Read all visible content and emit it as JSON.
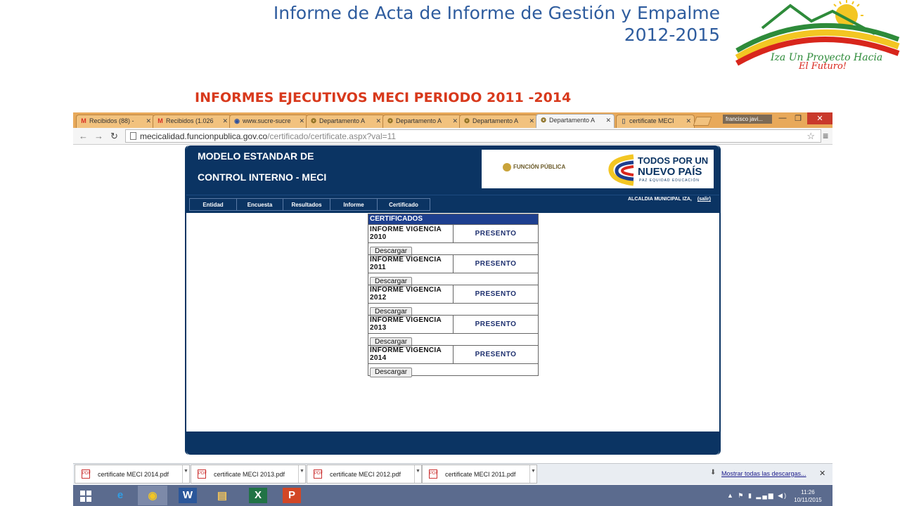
{
  "slide": {
    "title_line1": "Informe de Acta de Informe de Gestión y Empalme",
    "title_line2": "2012-2015",
    "subtitle": "INFORMES EJECUTIVOS MECI PERIODO 2011 -2014",
    "logo_text_line1": "Iza Un Proyecto Hacia",
    "logo_text_line2": "El Futuro!"
  },
  "browser": {
    "tabs": [
      {
        "label": "Recibidos (88) -",
        "icon": "gmail-icon",
        "active": false
      },
      {
        "label": "Recibidos (1.026",
        "icon": "gmail-icon",
        "active": false
      },
      {
        "label": "www.sucre-sucre",
        "icon": "globe-icon",
        "active": false
      },
      {
        "label": "Departamento A",
        "icon": "seal-icon",
        "active": false
      },
      {
        "label": "Departamento A",
        "icon": "seal-icon",
        "active": false
      },
      {
        "label": "Departamento A",
        "icon": "seal-icon",
        "active": false
      },
      {
        "label": "Departamento A",
        "icon": "seal-icon",
        "active": true
      },
      {
        "label": "certificate MECI",
        "icon": "page-icon",
        "active": false
      }
    ],
    "user": "francisco javi...",
    "url_host": "mecicalidad.funcionpublica.gov.co",
    "url_path": "/certificado/certificate.aspx?val=11",
    "colors": {
      "tabstrip": "#e8a95a",
      "meci_navy": "#0b3463",
      "table_header": "#1d3f8f"
    }
  },
  "meci": {
    "title_line1": "MODELO ESTANDAR DE",
    "title_line2": "CONTROL INTERNO - MECI",
    "logo_funcion": "FUNCIÓN PÚBLICA",
    "logo_todos_line1": "TODOS POR UN",
    "logo_todos_line2": "NUEVO PAÍS",
    "logo_todos_line3": "PAZ  EQUIDAD  EDUCACIÓN",
    "nav": [
      "Entidad",
      "Encuesta",
      "Resultados",
      "Informe",
      "Certificado"
    ],
    "user_label": "ALCALDIA MUNICIPAL IZA,",
    "logout_label": "(salir)",
    "table_title": "CERTIFICADOS",
    "download_label": "Descargar",
    "rows": [
      {
        "label_line1": "INFORME VIGENCIA",
        "label_line2": "2010",
        "status": "PRESENTO"
      },
      {
        "label_line1": "INFORME VIGENCIA",
        "label_line2": "2011",
        "status": "PRESENTO"
      },
      {
        "label_line1": "INFORME VIGENCIA",
        "label_line2": "2012",
        "status": "PRESENTO"
      },
      {
        "label_line1": "INFORME VIGENCIA",
        "label_line2": "2013",
        "status": "PRESENTO"
      },
      {
        "label_line1": "INFORME VIGENCIA",
        "label_line2": "2014",
        "status": "PRESENTO"
      }
    ]
  },
  "downloads": {
    "files": [
      "certificate MECI 2014.pdf",
      "certificate MECI 2013.pdf",
      "certificate MECI 2012.pdf",
      "certificate MECI 2011.pdf"
    ],
    "show_all": "Mostrar todas las descargas..."
  },
  "taskbar": {
    "apps": [
      {
        "name": "internet-explorer",
        "glyph": "e"
      },
      {
        "name": "chrome",
        "glyph": "◉"
      },
      {
        "name": "word",
        "glyph": "W"
      },
      {
        "name": "file-explorer",
        "glyph": "▤"
      },
      {
        "name": "excel",
        "glyph": "X"
      },
      {
        "name": "powerpoint",
        "glyph": "P"
      }
    ],
    "time": "11:26",
    "date": "10/11/2015"
  }
}
